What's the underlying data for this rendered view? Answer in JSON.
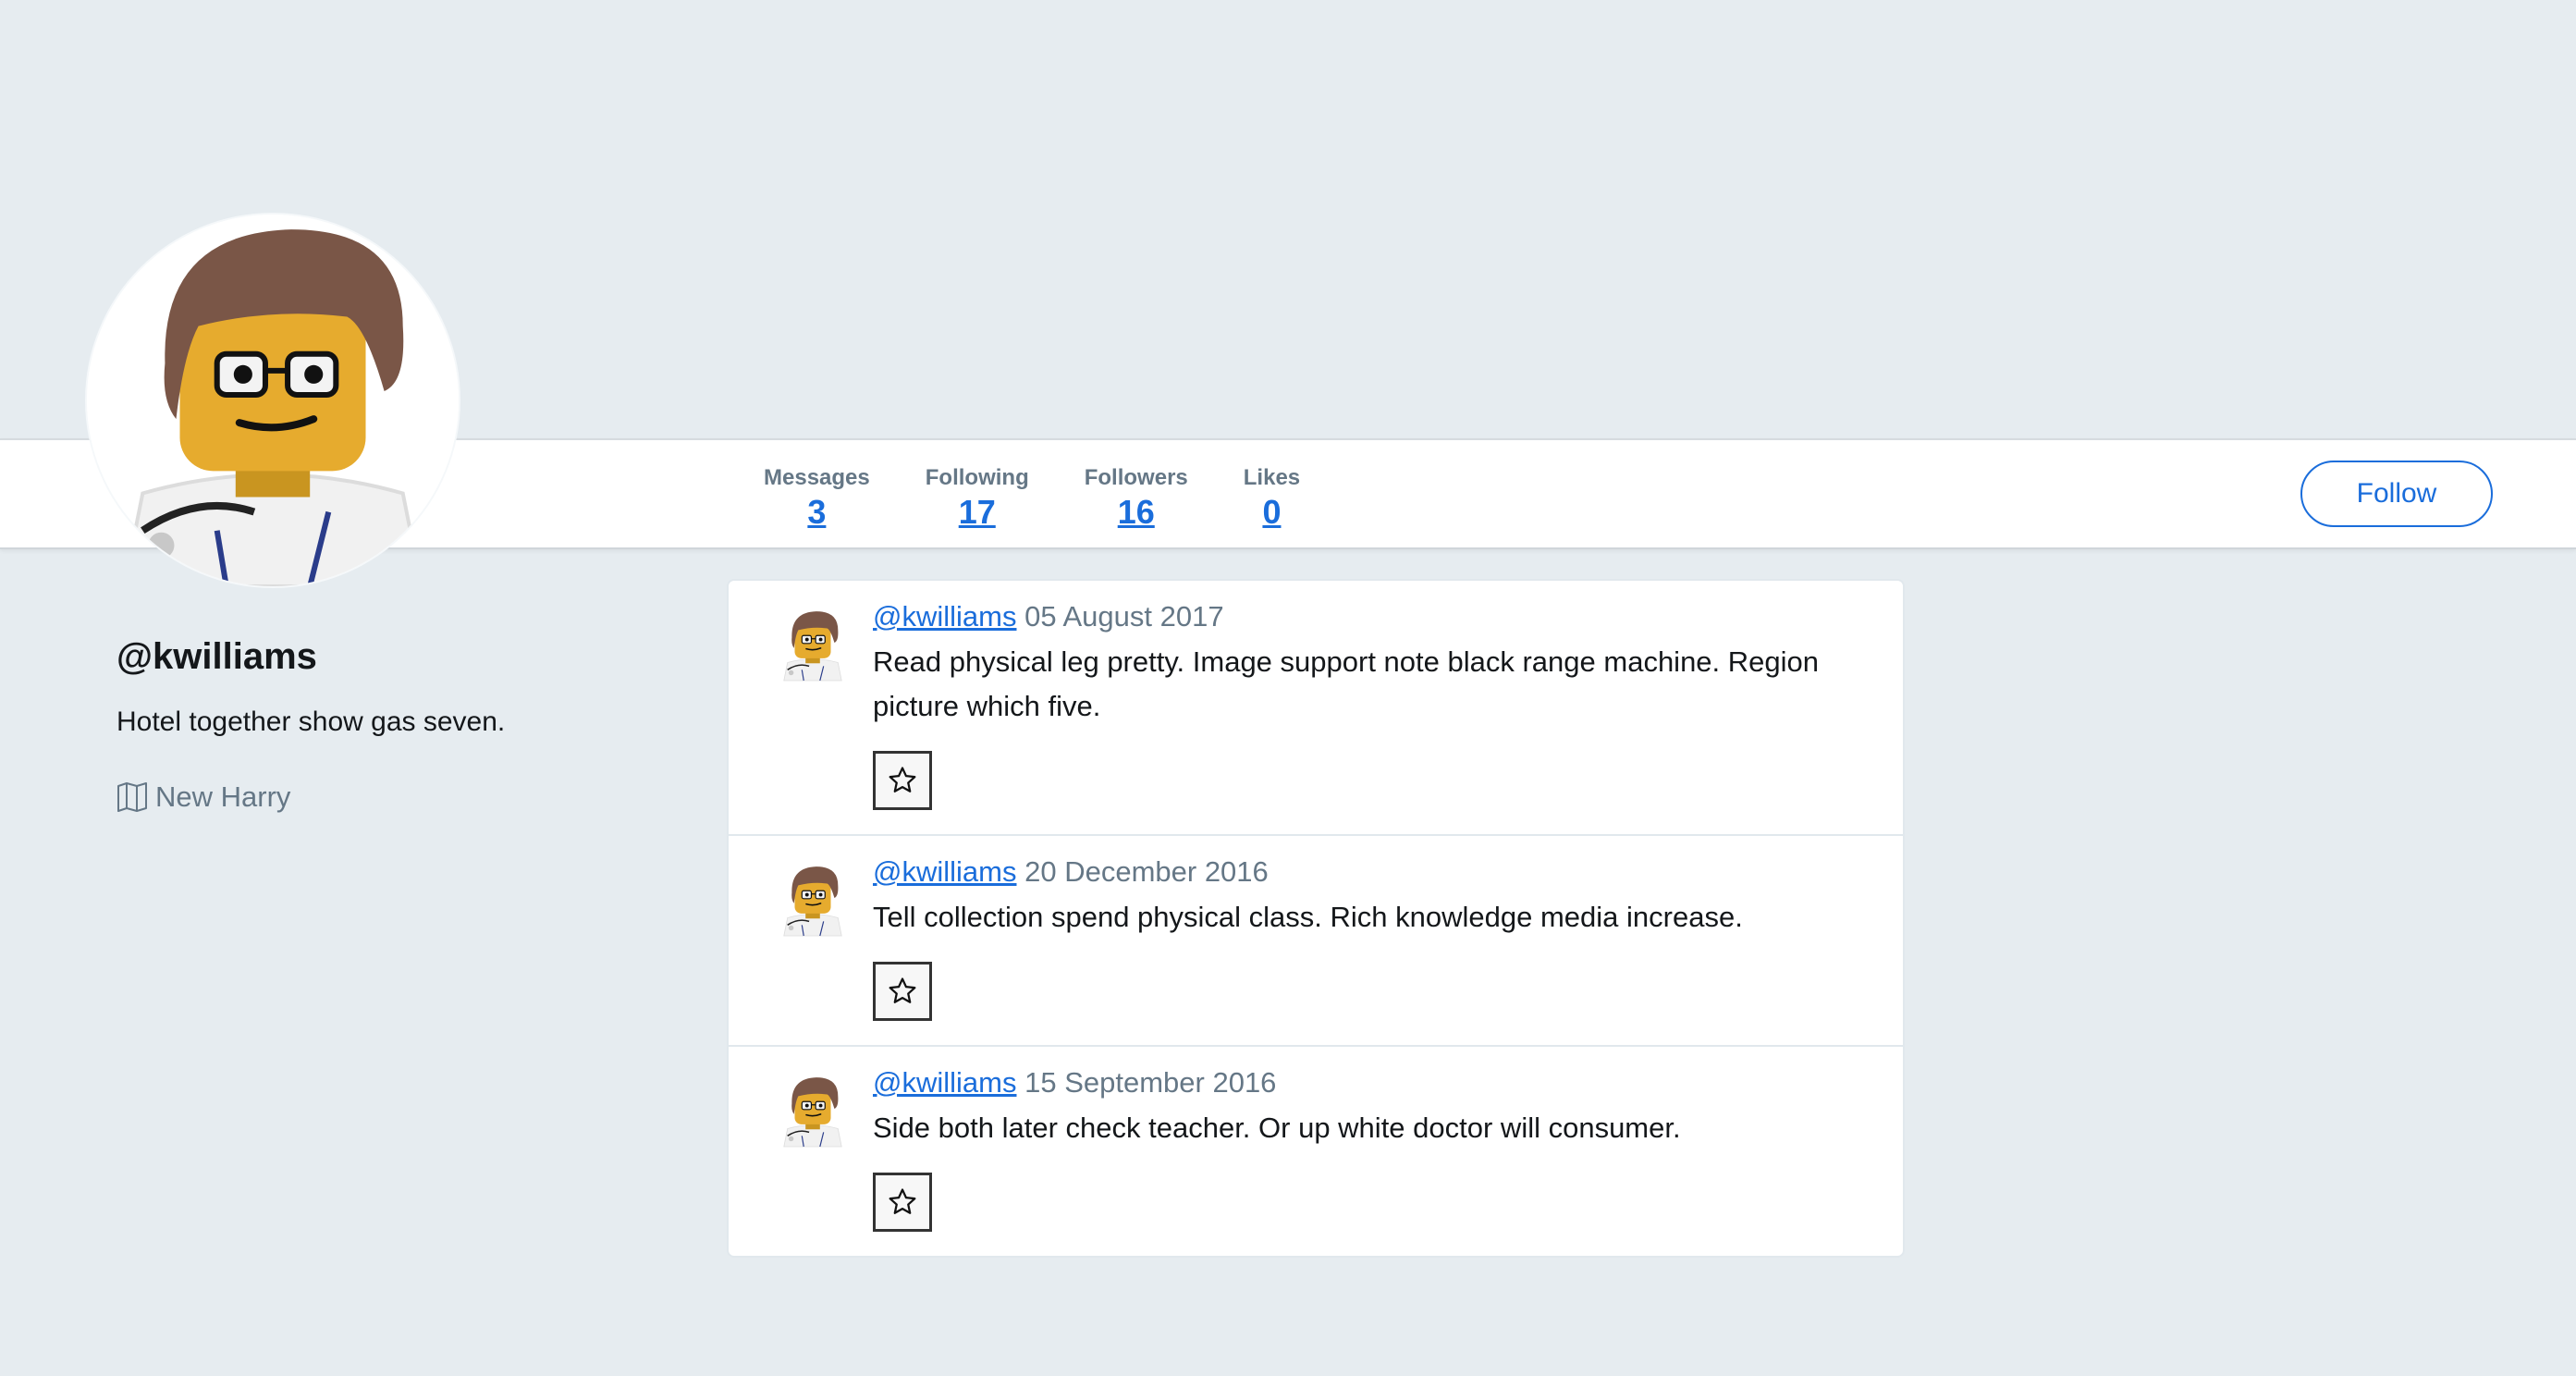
{
  "profile": {
    "handle": "@kwilliams",
    "bio": "Hotel together show gas seven.",
    "location": "New Harry",
    "avatar_icon": "lego-minifig-avatar",
    "location_icon": "map-icon"
  },
  "stats": [
    {
      "label": "Messages",
      "value": "3"
    },
    {
      "label": "Following",
      "value": "17"
    },
    {
      "label": "Followers",
      "value": "16"
    },
    {
      "label": "Likes",
      "value": "0"
    }
  ],
  "follow_label": "Follow",
  "messages": [
    {
      "user": "@kwilliams",
      "date": "05 August 2017",
      "text": "Read physical leg pretty. Image support note black range machine. Region picture which five."
    },
    {
      "user": "@kwilliams",
      "date": "20 December 2016",
      "text": "Tell collection spend physical class. Rich knowledge media increase."
    },
    {
      "user": "@kwilliams",
      "date": "15 September 2016",
      "text": "Side both later check teacher. Or up white doctor will consumer."
    }
  ],
  "colors": {
    "background": "#e6ecf0",
    "link": "#1a6ddb",
    "muted": "#657786"
  }
}
